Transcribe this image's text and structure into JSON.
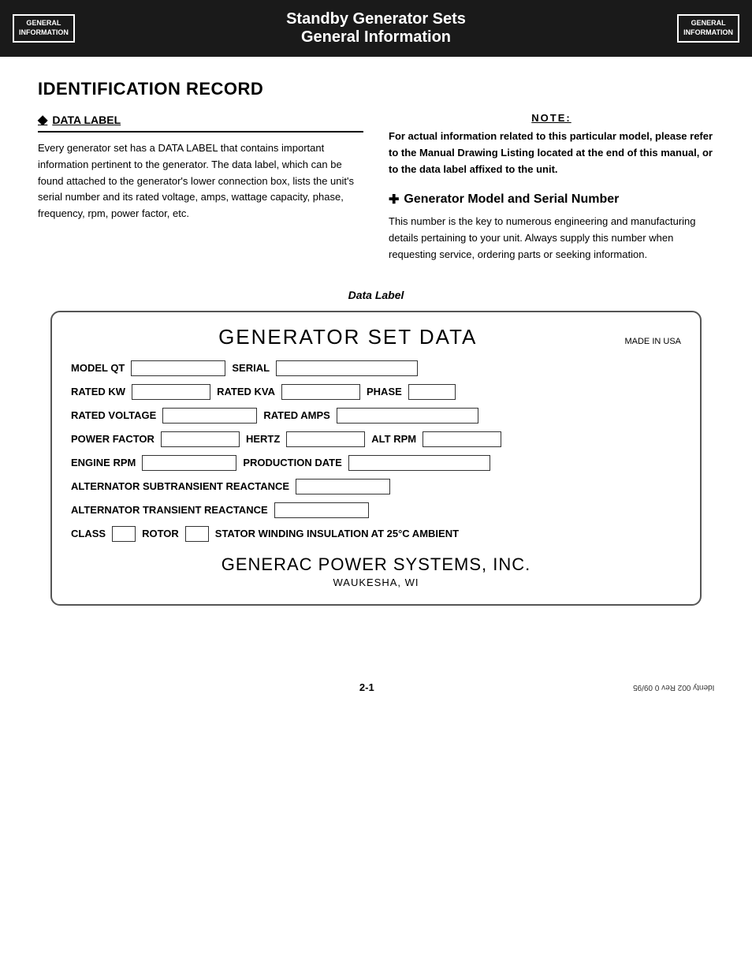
{
  "header": {
    "logo_line1": "GENERAL",
    "logo_line2": "INFORMATION",
    "title_line1": "Standby Generator Sets",
    "title_line2": "General Information"
  },
  "identification_record": {
    "section_title": "IDENTIFICATION RECORD",
    "data_label_heading": "DATA LABEL",
    "data_label_body": "Every generator set has a DATA LABEL that contains important information pertinent to the generator. The data label, which can be found attached to the generator's lower connection box, lists the unit's serial number and its rated voltage, amps, wattage capacity, phase, frequency, rpm, power factor, etc.",
    "note_heading": "NOTE:",
    "note_body": "For actual information related to this particular model, please refer to the Manual Drawing Listing located at the end of this manual, or to the data label affixed to the unit.",
    "gen_model_heading": "Generator Model and Serial Number",
    "gen_model_body": "This number is the key to numerous engineering and manufacturing details pertaining to your unit. Always supply this number when requesting service, ordering parts or seeking information."
  },
  "data_label_diagram": {
    "caption": "Data Label",
    "card_title": "GENERATOR SET DATA",
    "made_in": "MADE IN USA",
    "fields": {
      "model_label": "MODEL  QT",
      "serial_label": "SERIAL",
      "rated_kw_label": "RATED KW",
      "rated_kva_label": "RATED KVA",
      "phase_label": "PHASE",
      "rated_voltage_label": "RATED VOLTAGE",
      "rated_amps_label": "RATED AMPS",
      "power_factor_label": "POWER FACTOR",
      "hertz_label": "HERTZ",
      "alt_rpm_label": "ALT RPM",
      "engine_rpm_label": "ENGINE RPM",
      "production_date_label": "PRODUCTION DATE",
      "alt_subtransient_label": "ALTERNATOR SUBTRANSIENT REACTANCE",
      "alt_transient_label": "ALTERNATOR TRANSIENT REACTANCE",
      "class_label": "CLASS",
      "rotor_label": "ROTOR",
      "stator_winding_label": "STATOR  WINDING INSULATION AT 25°C AMBIENT"
    },
    "footer_name": "GENERAC POWER SYSTEMS, INC.",
    "footer_city": "WAUKESHA, WI"
  },
  "page_footer": {
    "page_number": "2-1",
    "footer_right": "Identy 002  Rev 0  09/95"
  }
}
